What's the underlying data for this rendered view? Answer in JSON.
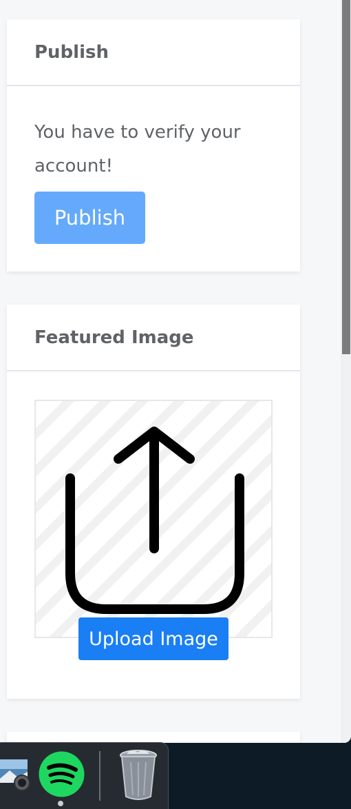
{
  "publish": {
    "title": "Publish",
    "message": "You have to verify your account!",
    "button_label": "Publish"
  },
  "featured_image": {
    "title": "Featured Image",
    "upload_label": "Upload Image"
  },
  "colors": {
    "publish_button": "#64a9fb",
    "upload_button": "#1a7ef5",
    "heading_text": "#5f6266",
    "spotify_green": "#1ed760"
  },
  "dock": {
    "icons": [
      "photo-app-icon",
      "spotify-icon",
      "trash-icon"
    ]
  }
}
